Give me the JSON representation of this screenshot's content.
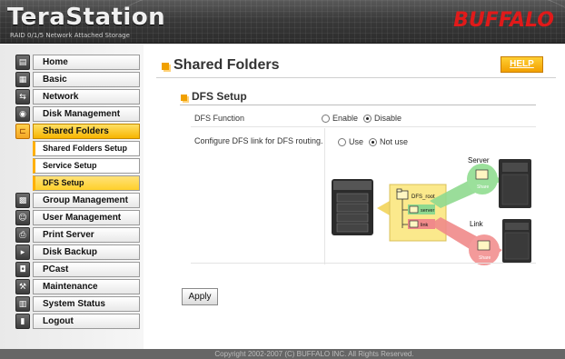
{
  "header": {
    "product": "TeraStation",
    "subtitle": "RAID 0/1/5 Network Attached Storage",
    "brand": "BUFFALO"
  },
  "nav": {
    "items": [
      {
        "label": "Home",
        "icon": "home-icon"
      },
      {
        "label": "Basic",
        "icon": "basic-icon"
      },
      {
        "label": "Network",
        "icon": "network-icon"
      },
      {
        "label": "Disk Management",
        "icon": "disk-icon"
      },
      {
        "label": "Shared Folders",
        "icon": "folder-icon",
        "active": true
      },
      {
        "label": "Group Management",
        "icon": "group-icon"
      },
      {
        "label": "User Management",
        "icon": "user-icon"
      },
      {
        "label": "Print Server",
        "icon": "printer-icon"
      },
      {
        "label": "Disk Backup",
        "icon": "backup-icon"
      },
      {
        "label": "PCast",
        "icon": "pcast-icon"
      },
      {
        "label": "Maintenance",
        "icon": "maintenance-icon"
      },
      {
        "label": "System Status",
        "icon": "status-icon"
      },
      {
        "label": "Logout",
        "icon": "logout-icon"
      }
    ],
    "sub_items": [
      {
        "label": "Shared Folders Setup"
      },
      {
        "label": "Service Setup"
      },
      {
        "label": "DFS Setup",
        "active": true
      }
    ]
  },
  "main": {
    "title": "Shared Folders",
    "help_label": "HELP",
    "section_title": "DFS Setup",
    "dfs_function": {
      "label": "DFS Function",
      "options": [
        "Enable",
        "Disable"
      ],
      "selected": "Disable"
    },
    "dfs_link": {
      "label": "Configure DFS link for DFS routing.",
      "options": [
        "Use",
        "Not use"
      ],
      "selected": "Not use"
    },
    "diagram": {
      "root": "DFS_root",
      "folder_server": "server",
      "folder_link": "link",
      "server_label": "Server",
      "link_label": "Link",
      "share_label": "Share"
    },
    "apply_label": "Apply"
  },
  "footer": {
    "copyright": "Copyright 2002-2007 (C) BUFFALO INC. All Rights Reserved."
  },
  "colors": {
    "accent": "#f5a623",
    "brand_red": "#e01a1a",
    "header_bg": "#3a3a3a",
    "link_green": "#7fd17f",
    "link_red": "#ef7f7f"
  }
}
